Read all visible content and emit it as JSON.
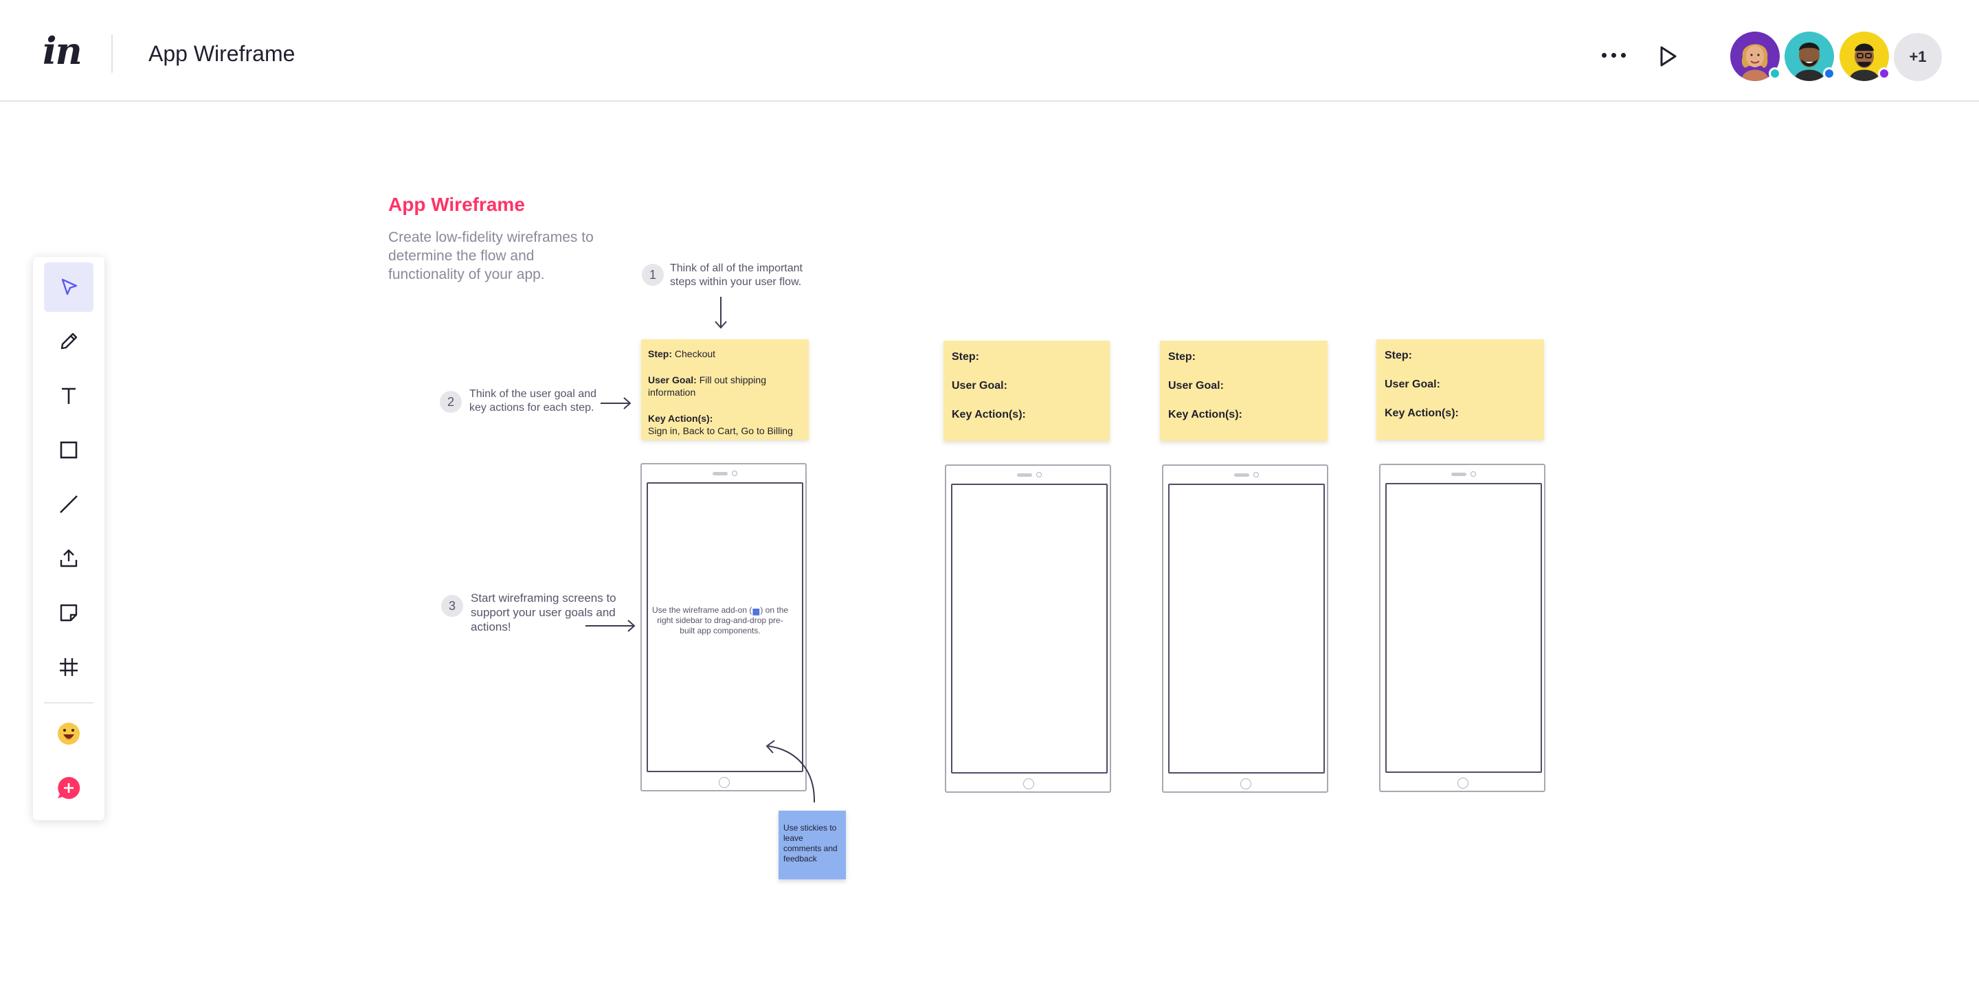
{
  "header": {
    "logo": "in",
    "title": "App Wireframe",
    "more_icon": "more-horizontal-icon",
    "play_icon": "play-icon",
    "avatars": [
      {
        "name": "collaborator-1",
        "bg": "#6b2fb8",
        "status": "#22c3c3"
      },
      {
        "name": "collaborator-2",
        "bg": "#3cc3c9",
        "status": "#1a73e8"
      },
      {
        "name": "collaborator-3",
        "bg": "#f5d31b",
        "status": "#8a2be2"
      }
    ],
    "more_count": "+1"
  },
  "toolbar": {
    "tools": [
      {
        "name": "select",
        "icon": "cursor-arrow-icon",
        "active": true
      },
      {
        "name": "pencil",
        "icon": "pencil-icon"
      },
      {
        "name": "text",
        "icon": "text-icon"
      },
      {
        "name": "rectangle",
        "icon": "rectangle-icon"
      },
      {
        "name": "line",
        "icon": "line-icon"
      },
      {
        "name": "upload",
        "icon": "upload-icon"
      },
      {
        "name": "sticky-note",
        "icon": "sticky-note-icon"
      },
      {
        "name": "frame",
        "icon": "frame-hash-icon"
      },
      {
        "name": "emoji",
        "icon": "emoji-icon"
      },
      {
        "name": "add",
        "icon": "plus-circle-icon"
      }
    ],
    "accent": "#5a5af2",
    "add_color": "#ff3366"
  },
  "board": {
    "title": "App Wireframe",
    "description": "Create low-fidelity wireframes to determine the flow and functionality of your app.",
    "steps": [
      {
        "num": "1",
        "text_line1": "Think of all of the important",
        "text_line2": "steps within your user flow."
      },
      {
        "num": "2",
        "text_line1": "Think of the user goal and",
        "text_line2": "key actions for each step."
      },
      {
        "num": "3",
        "text_line1": "Start wireframing screens to",
        "text_line2": "support your user goals and",
        "text_line3": "actions!"
      }
    ],
    "filled_sticky": {
      "step_label": "Step:",
      "step_value": "Checkout",
      "goal_label": "User Goal:",
      "goal_value": "Fill out shipping information",
      "actions_label": "Key Action(s):",
      "actions_value": "Sign in, Back to Cart, Go to Billing"
    },
    "blank_sticky": {
      "step_label": "Step:",
      "goal_label": "User Goal:",
      "actions_label": "Key Action(s):"
    },
    "phone_hint_before": "Use the wireframe add-on (",
    "phone_hint_after": ") on the right sidebar to drag-and-drop pre-built app components.",
    "blue_sticky": "Use stickies to leave comments and feedback",
    "sticky_color": "#fdeaa2",
    "blue_sticky_color": "#8fb1f0",
    "title_color": "#ff3366"
  }
}
